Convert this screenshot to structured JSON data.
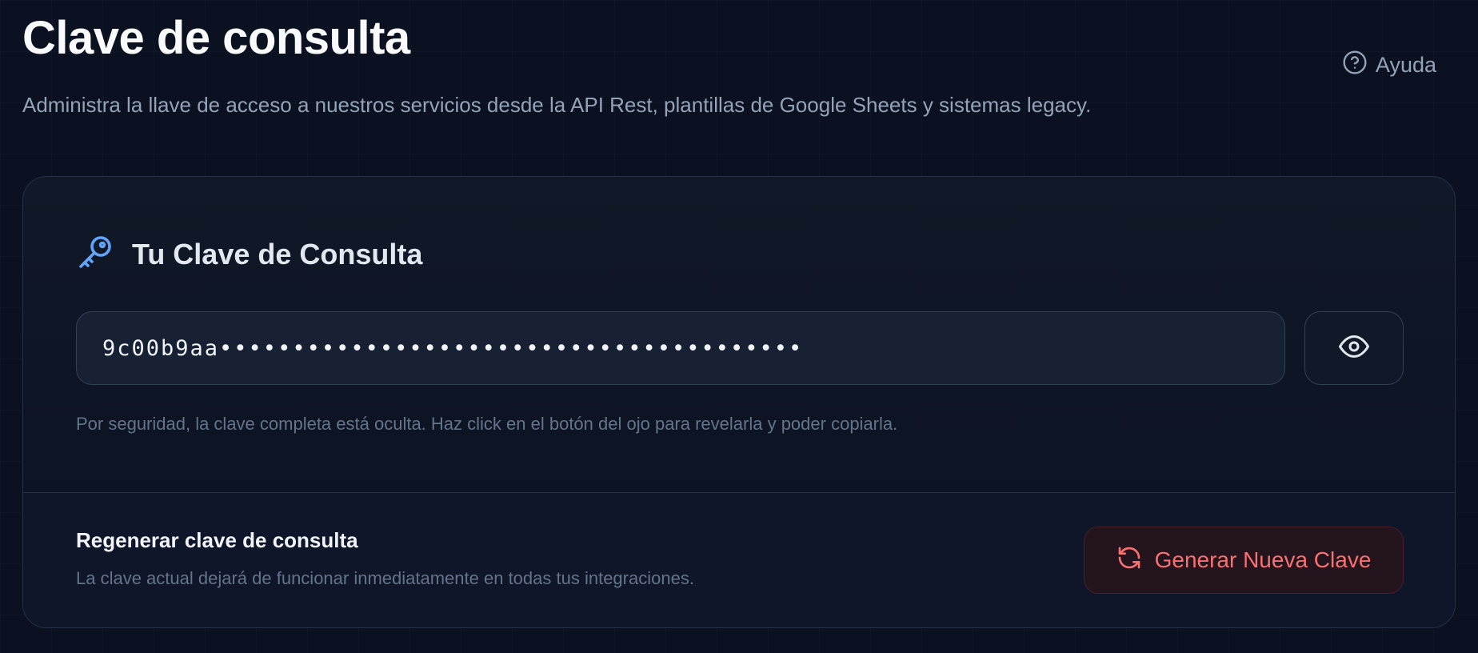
{
  "header": {
    "title": "Clave de consulta",
    "subtitle": "Administra la llave de acceso a nuestros servicios desde la API Rest, plantillas de Google Sheets y sistemas legacy.",
    "help_label": "Ayuda",
    "help_icon": "help-circle-icon"
  },
  "key_card": {
    "icon": "key-icon",
    "title": "Tu Clave de Consulta",
    "key_value": "9c00b9aa••••••••••••••••••••••••••••••••••••••••",
    "reveal_icon": "eye-icon",
    "hint": "Por seguridad, la clave completa está oculta. Haz click en el botón del ojo para revelarla y poder copiarla."
  },
  "regenerate": {
    "title": "Regenerar clave de consulta",
    "description": "La clave actual dejará de funcionar inmediatamente en todas tus integraciones.",
    "button_label": "Generar Nueva Clave",
    "button_icon": "refresh-icon"
  },
  "colors": {
    "background": "#0b1120",
    "accent": "#60a5fa",
    "danger": "#f87171",
    "muted": "#64748b"
  }
}
